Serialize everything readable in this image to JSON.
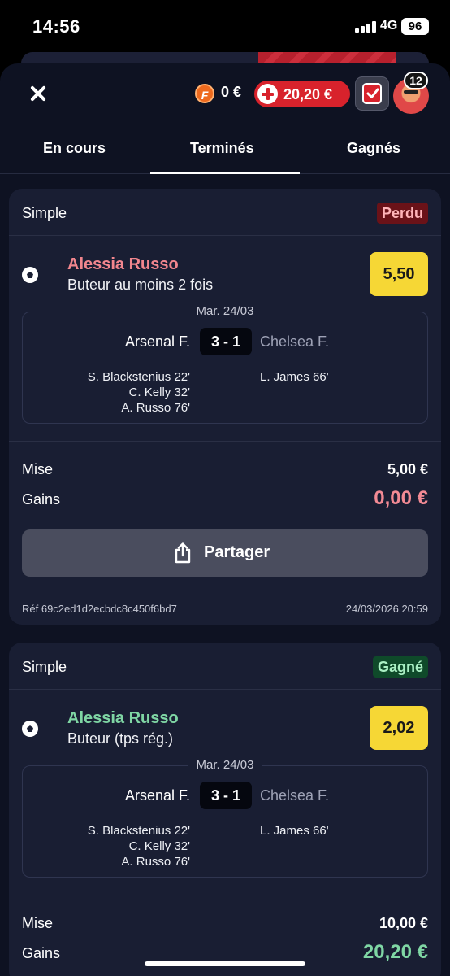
{
  "status_bar": {
    "time": "14:56",
    "network": "4G",
    "battery": "96"
  },
  "header": {
    "f_coin_letter": "F",
    "f_balance": "0 €",
    "balance": "20,20 €",
    "notifications": "12"
  },
  "tabs": [
    {
      "label": "En cours",
      "active": false
    },
    {
      "label": "Terminés",
      "active": true
    },
    {
      "label": "Gagnés",
      "active": false
    }
  ],
  "bets": [
    {
      "type": "Simple",
      "status": "Perdu",
      "player": "Alessia Russo",
      "player_color": "#f2868e",
      "market": "Buteur au moins 2 fois",
      "odds": "5,50",
      "date": "Mar. 24/03",
      "home_team": "Arsenal F.",
      "away_team": "Chelsea F.",
      "score": "3 - 1",
      "home_scorers": [
        "S. Blackstenius 22'",
        "C. Kelly 32'",
        "A. Russo 76'"
      ],
      "away_scorers": [
        "L. James 66'"
      ],
      "stake_label": "Mise",
      "stake": "5,00 €",
      "gain_label": "Gains",
      "gain": "0,00 €",
      "gain_color": "#f28a94",
      "share_label": "Partager",
      "ref": "Réf 69c2ed1d2ecbdc8c450f6bd7",
      "placed_at": "24/03/2026 20:59"
    },
    {
      "type": "Simple",
      "status": "Gagné",
      "player": "Alessia Russo",
      "player_color": "#7fd6a4",
      "market": "Buteur (tps rég.)",
      "odds": "2,02",
      "date": "Mar. 24/03",
      "home_team": "Arsenal F.",
      "away_team": "Chelsea F.",
      "score": "3 - 1",
      "home_scorers": [
        "S. Blackstenius 22'",
        "C. Kelly 32'",
        "A. Russo 76'"
      ],
      "away_scorers": [
        "L. James 66'"
      ],
      "stake_label": "Mise",
      "stake": "10,00 €",
      "gain_label": "Gains",
      "gain": "20,20 €",
      "gain_color": "#7fd6a4"
    }
  ]
}
